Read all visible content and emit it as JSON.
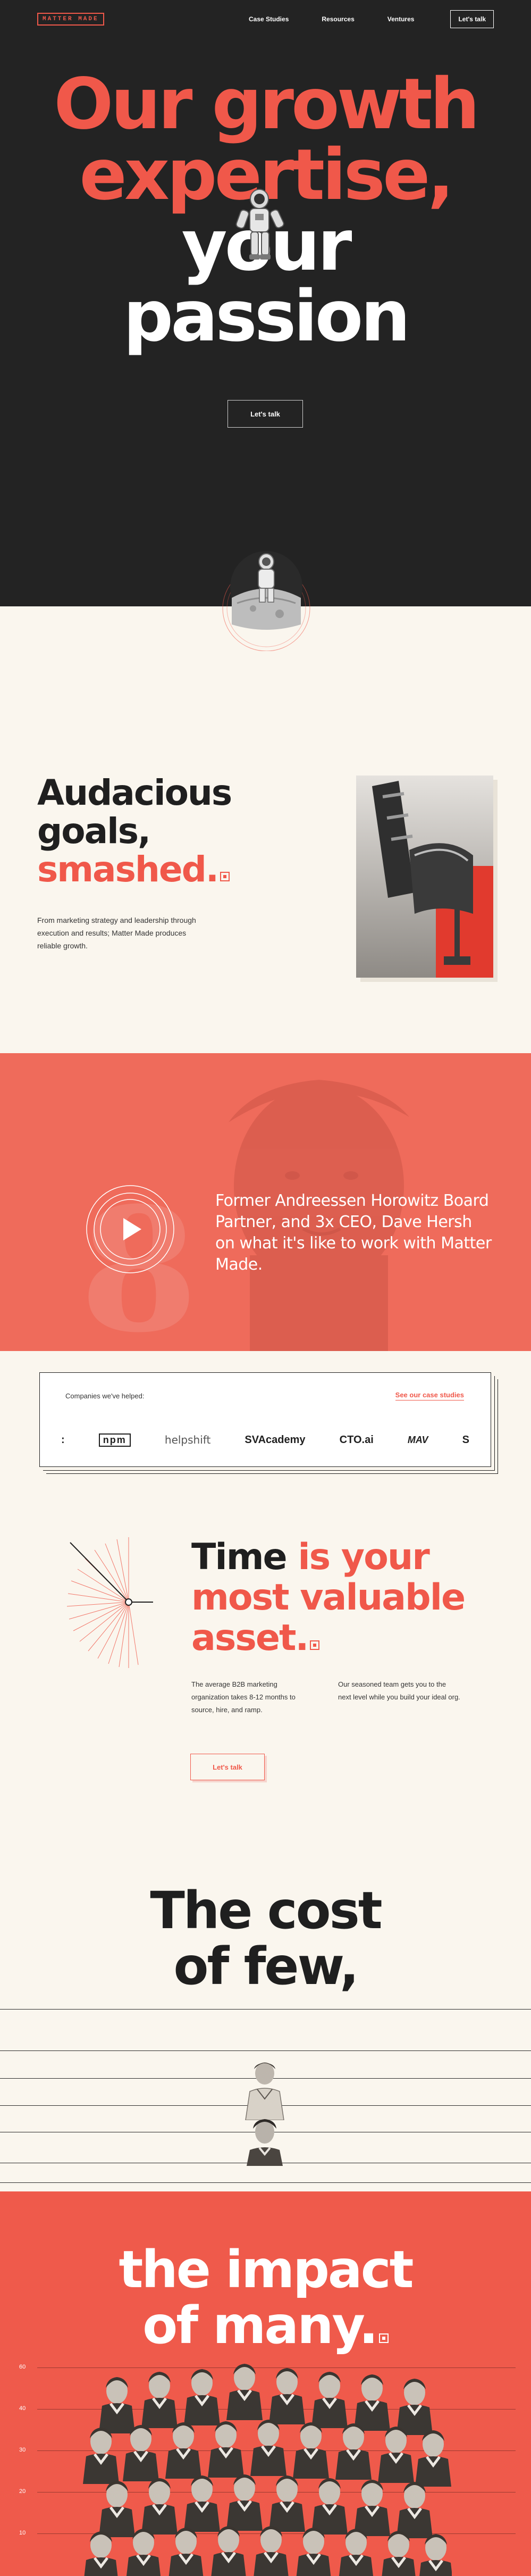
{
  "nav": {
    "logo": "MATTER MADE",
    "links": [
      "Case Studies",
      "Resources",
      "Ventures"
    ],
    "cta": "Let's talk"
  },
  "hero": {
    "title_line1": "Our growth",
    "title_line2": "expertise,",
    "title_line3": "your",
    "title_line4": "passion",
    "cta": "Let's talk"
  },
  "goals": {
    "title_line1": "Audacious",
    "title_line2": "goals,",
    "title_line3": "smashed.",
    "body": "From marketing strategy and leadership through execution and results; Matter Made produces reliable growth."
  },
  "video": {
    "quote": "Former Andreessen Horowitz Board Partner, and 3x CEO, Dave Hersh on what it's like to work with Matter Made."
  },
  "companies": {
    "label": "Companies we've helped:",
    "link": "See our case studies",
    "logos": [
      ":",
      "npm",
      "helpshift",
      "SVAcademy",
      "CTO.ai",
      "MAV",
      "S"
    ]
  },
  "time": {
    "title_line1a": "Time ",
    "title_line1b": "is your",
    "title_line2": "most valuable",
    "title_line3": "asset.",
    "col1": "The average B2B marketing organization takes 8-12 months to source, hire, and ramp.",
    "col2": "Our seasoned team gets you to the next level while you build your ideal org.",
    "cta": "Let's talk"
  },
  "few": {
    "title_line1": "The cost",
    "title_line2": "of few,"
  },
  "impact": {
    "title_line1": "the impact",
    "title_line2": "of many.",
    "axis": [
      "60",
      "40",
      "30",
      "20",
      "10"
    ]
  },
  "colors": {
    "accent": "#f0584a",
    "dark": "#232323",
    "cream": "#faf6ee"
  }
}
